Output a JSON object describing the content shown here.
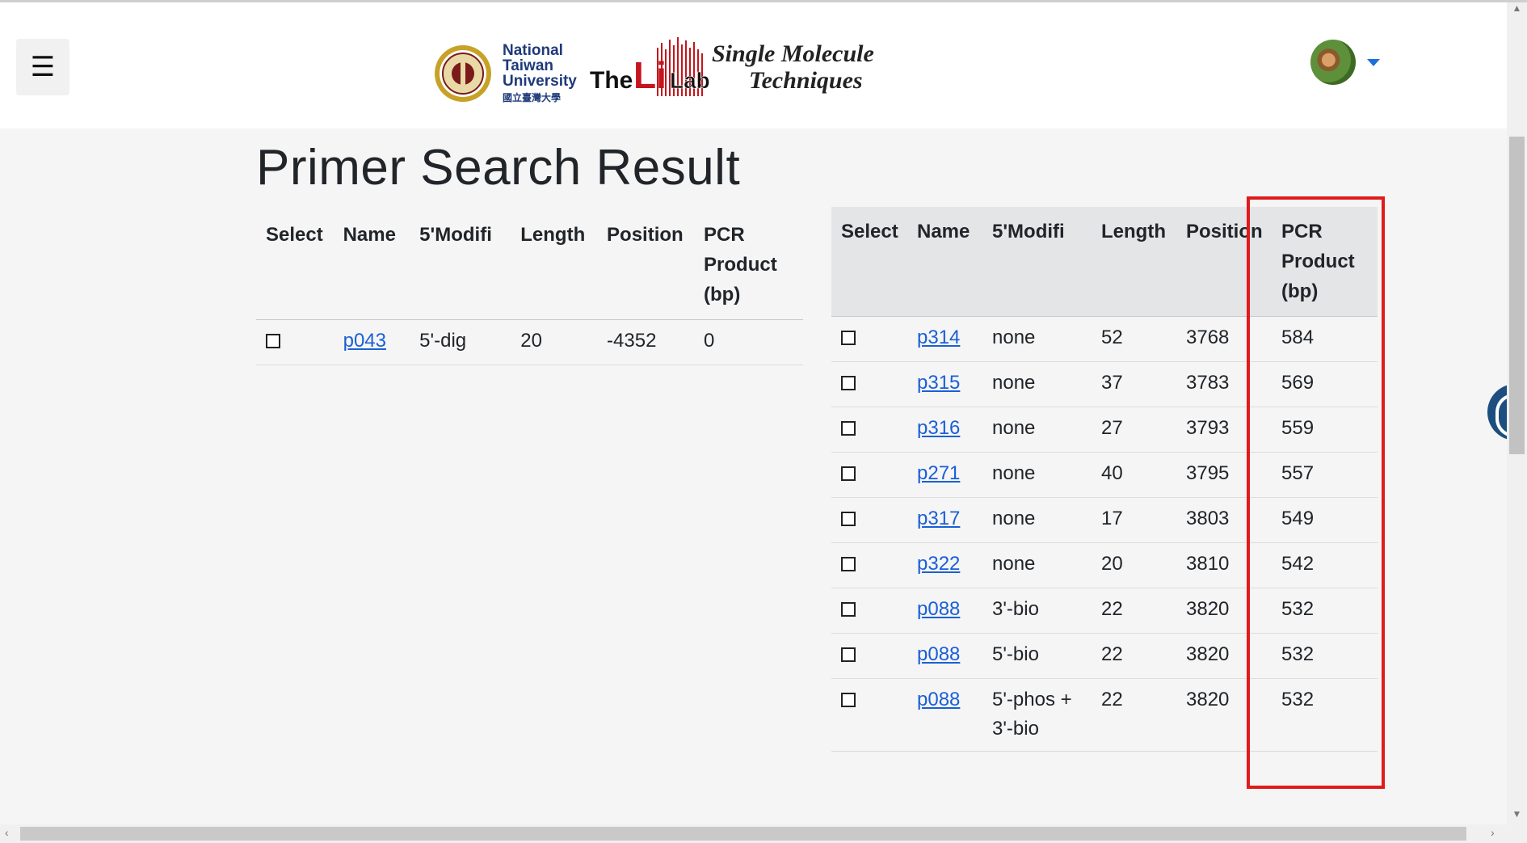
{
  "header": {
    "menu_icon": "hamburger-icon",
    "logo": {
      "line1": "National",
      "line2": "Taiwan",
      "line3": "University",
      "cn": "國立臺灣大學",
      "the": "The",
      "li": "Li",
      "lab": "Lab",
      "tag1": "Single Molecule",
      "tag2": "Techniques"
    },
    "avatar_icon": "user-avatar",
    "dropdown_icon": "caret-down-icon"
  },
  "page_title": "Primer Search Result",
  "left_table": {
    "headers": [
      "Select",
      "Name",
      "5'Modifi",
      "Length",
      "Position",
      "PCR Product (bp)"
    ],
    "rows": [
      {
        "name": "p043",
        "mod": "5'-dig",
        "length": "20",
        "position": "-4352",
        "pcr": "0"
      }
    ]
  },
  "right_table": {
    "headers": [
      "Select",
      "Name",
      "5'Modifi",
      "Length",
      "Position",
      "PCR Product (bp)"
    ],
    "rows": [
      {
        "name": "p314",
        "mod": "none",
        "length": "52",
        "position": "3768",
        "pcr": "584"
      },
      {
        "name": "p315",
        "mod": "none",
        "length": "37",
        "position": "3783",
        "pcr": "569"
      },
      {
        "name": "p316",
        "mod": "none",
        "length": "27",
        "position": "3793",
        "pcr": "559"
      },
      {
        "name": "p271",
        "mod": "none",
        "length": "40",
        "position": "3795",
        "pcr": "557"
      },
      {
        "name": "p317",
        "mod": "none",
        "length": "17",
        "position": "3803",
        "pcr": "549"
      },
      {
        "name": "p322",
        "mod": "none",
        "length": "20",
        "position": "3810",
        "pcr": "542"
      },
      {
        "name": "p088",
        "mod": "3'-bio",
        "length": "22",
        "position": "3820",
        "pcr": "532"
      },
      {
        "name": "p088",
        "mod": "5'-bio",
        "length": "22",
        "position": "3820",
        "pcr": "532"
      },
      {
        "name": "p088",
        "mod": "5'-phos + 3'-bio",
        "length": "22",
        "position": "3820",
        "pcr": "532"
      }
    ]
  },
  "colors": {
    "link": "#1a5fd6",
    "highlight": "#e01b1b",
    "header_bg": "#e4e5e7"
  }
}
